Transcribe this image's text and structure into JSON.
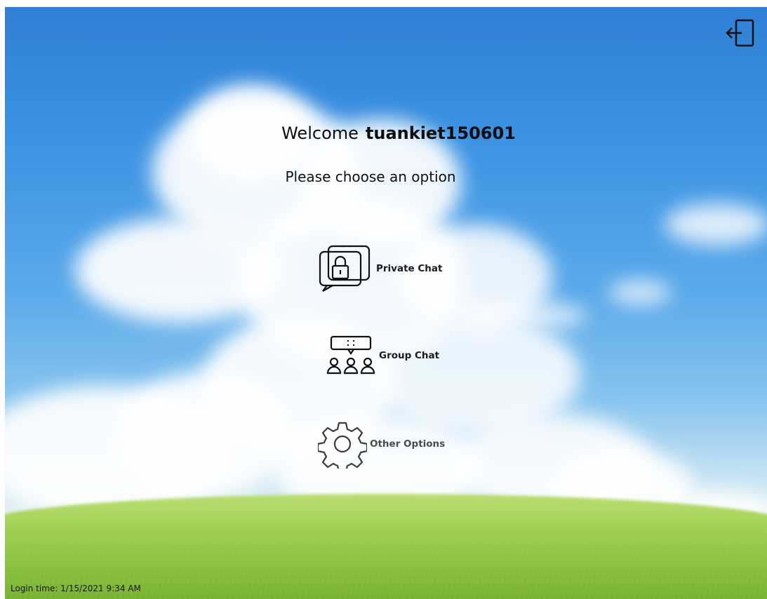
{
  "header": {
    "welcome_prefix": "Welcome",
    "username": "tuankiet150601",
    "subtitle": "Please choose an option",
    "logout_icon": "logout-icon"
  },
  "options": [
    {
      "label": "Private Chat",
      "icon": "private-chat-lock-icon"
    },
    {
      "label": "Group Chat",
      "icon": "group-chat-icon"
    },
    {
      "label": "Other Options",
      "icon": "gear-icon"
    }
  ],
  "footer": {
    "login_time": "Login time: 1/15/2021 9:34 AM"
  },
  "colors": {
    "sky_top": "#2f7fd6",
    "grass": "#9fcf4f",
    "text": "#0d0d0d"
  }
}
